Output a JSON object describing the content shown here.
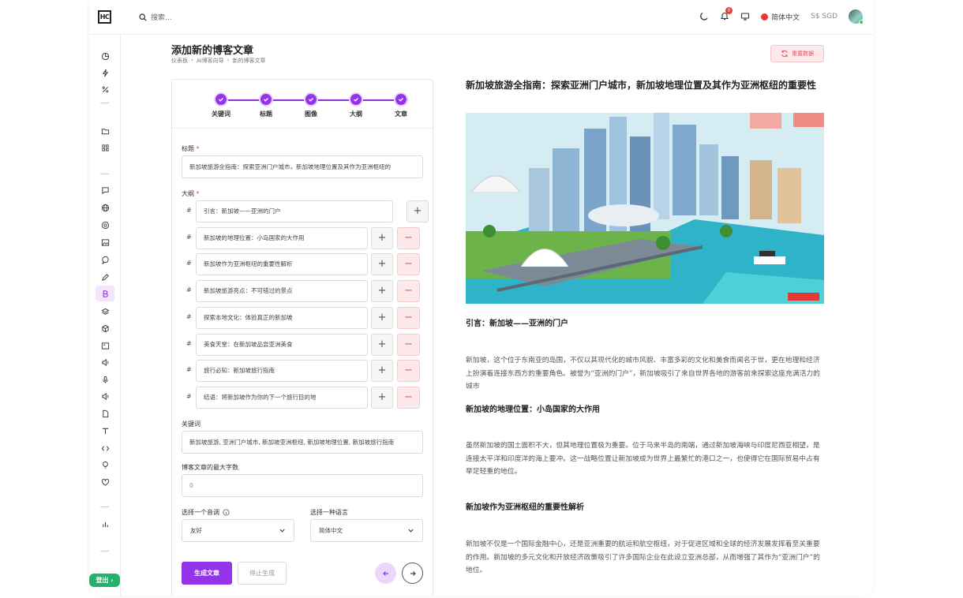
{
  "topbar": {
    "logo_text": "HC",
    "search_placeholder": "搜索...",
    "notification_count": "0",
    "language": "简体中文",
    "currency": "S$ SGD"
  },
  "sidebar": {
    "logout_label": "登出"
  },
  "header": {
    "title": "添加新的博客文章",
    "breadcrumb": [
      "仪表板",
      "AI博客向导",
      "新的博客文章"
    ],
    "reset_label": "重置数据"
  },
  "stepper": {
    "steps": [
      "关键词",
      "标题",
      "图像",
      "大纲",
      "文章"
    ]
  },
  "form": {
    "title_label": "标题",
    "title_value": "新加坡旅游全指南：探索亚洲门户城市，新加坡地理位置及其作为亚洲枢纽的",
    "outline_label": "大纲",
    "outline_items": [
      "引言：新加坡——亚洲的门户",
      "新加坡的地理位置：小岛国家的大作用",
      "新加坡作为亚洲枢纽的重要性解析",
      "新加坡旅游亮点：不可错过的景点",
      "探索本地文化：体验真正的新加坡",
      "美食天堂：在新加坡品尝亚洲美食",
      "旅行必知：新加坡旅行指南",
      "结语：将新加坡作为你的下一个旅行目的地"
    ],
    "keywords_label": "关键词",
    "keywords_value": "新加坡旅游, 亚洲门户城市, 新加坡亚洲枢纽, 新加坡地理位置, 新加坡旅行指南",
    "max_words_label": "博客文章的最大字数",
    "max_words_value": "0",
    "tone_label": "选择一个音调",
    "tone_value": "友好",
    "language_label": "选择一种语言",
    "language_value": "简体中文",
    "generate_label": "生成文章",
    "stop_label": "停止生成"
  },
  "article": {
    "title": "新加坡旅游全指南：探索亚洲门户城市，新加坡地理位置及其作为亚洲枢纽的重要性",
    "sections": [
      {
        "heading": "引言：新加坡——亚洲的门户",
        "body": "新加坡，这个位于东南亚的岛国，不仅以其现代化的城市风貌、丰富多彩的文化和美食而闻名于世，更在地理和经济上扮演着连接东西方的重要角色。被誉为“亚洲的门户”，新加坡吸引了来自世界各地的游客前来探索这座充满活力的城市"
      },
      {
        "heading": "新加坡的地理位置：小岛国家的大作用",
        "body": "虽然新加坡的国土面积不大，但其地理位置极为重要。位于马来半岛的南端，通过新加坡海峡与印度尼西亚相望，是连接太平洋和印度洋的海上要冲。这一战略位置让新加坡成为世界上最繁忙的港口之一，也使得它在国际贸易中占有举足轻重的地位。"
      },
      {
        "heading": "新加坡作为亚洲枢纽的重要性解析",
        "body": "新加坡不仅是一个国际金融中心，还是亚洲重要的航运和航空枢纽，对于促进区域和全球的经济发展发挥着至关重要的作用。新加坡的多元文化和开放经济政策吸引了许多国际企业在此设立亚洲总部，从而增强了其作为“亚洲门户”的地位。"
      }
    ]
  },
  "colors": {
    "accent": "#9333ea",
    "danger": "#e05563",
    "success": "#22b36b"
  }
}
